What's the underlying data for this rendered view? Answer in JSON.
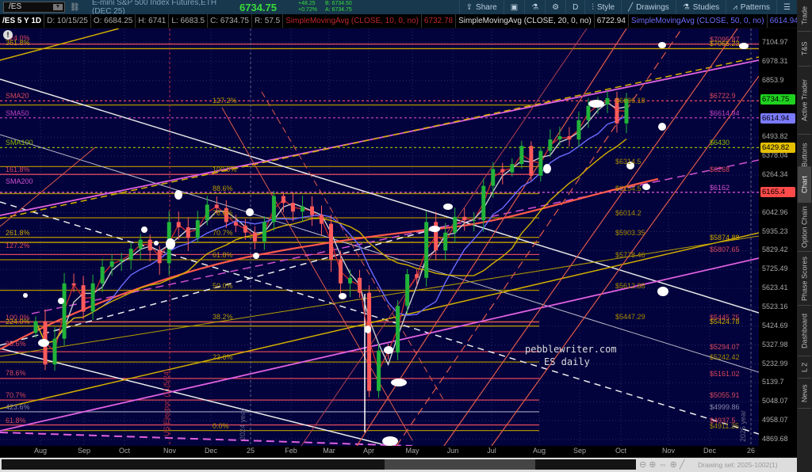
{
  "header": {
    "symbol": "/ES",
    "description": "E-mini S&P 500 Index Futures,ETH (DEC 25)",
    "last": "6734.75",
    "change": "+48.25",
    "change_pct": "+0.72%",
    "bid": "B: 6734.50",
    "ask": "A: 6734.75",
    "toolbar": [
      {
        "label": "Share",
        "icon": "share-icon"
      },
      {
        "label": "",
        "icon": "alert-icon"
      },
      {
        "label": "",
        "icon": "flask-icon"
      },
      {
        "label": "",
        "icon": "gear-icon"
      },
      {
        "label": "D",
        "icon": ""
      },
      {
        "label": "Style",
        "icon": "style-icon"
      },
      {
        "label": "Drawings",
        "icon": "pencil-icon"
      },
      {
        "label": "Studies",
        "icon": "flask-icon"
      },
      {
        "label": "Patterns",
        "icon": "patterns-icon"
      },
      {
        "label": "",
        "icon": "menu-icon"
      }
    ]
  },
  "status": {
    "period": "/ES 5 Y 1D",
    "date": "D: 10/15/25",
    "open": "O: 6684.25",
    "high": "H: 6741",
    "low": "L: 6683.5",
    "close": "C: 6734.75",
    "range": "R: 57.5",
    "studies": [
      {
        "name": "SimpleMovingAvg (CLOSE, 10, 0, no)",
        "value": "6732.78",
        "color": "#c0282d"
      },
      {
        "name": "SimpleMovingAvg (CLOSE, 20, 0, no)",
        "value": "6722.94",
        "color": "#dddddd"
      },
      {
        "name": "SimpleMovingAvg (CLOSE, 50, 0, no)",
        "value": "6614.94",
        "color": "#6b6bff"
      },
      {
        "name": "SimpleMoving...",
        "value": "",
        "color": "#d4b000"
      }
    ]
  },
  "axis": {
    "ticks": [
      "7104.97",
      "6978.31",
      "6853.9",
      "6493.82",
      "6378.04",
      "6264.34",
      "6042.96",
      "5935.23",
      "5829.42",
      "5725.49",
      "5623.41",
      "5523.16",
      "5424.69",
      "5327.98",
      "5232.99",
      "5139.7",
      "5048.07",
      "4958.07",
      "4869.68"
    ],
    "tags": [
      {
        "v": "6734.75",
        "color": "#1fd11f"
      },
      {
        "v": "6614.94",
        "color": "#7a7aff"
      },
      {
        "v": "6429.82",
        "color": "#e4c000"
      },
      {
        "v": "6165.4",
        "color": "#ff4a4a"
      }
    ]
  },
  "months": [
    "Aug",
    "Sep",
    "Oct",
    "Nov",
    "Dec",
    "25",
    "Feb",
    "Mar",
    "Apr",
    "May",
    "Jun",
    "Jul",
    "Aug",
    "Sep",
    "Oct",
    "Nov",
    "Dec",
    "26"
  ],
  "side_tabs": [
    "Trade",
    "T&S",
    "Active Trader",
    "Buttons",
    "Chart",
    "Option Chain",
    "Phase Scores",
    "Dashboard",
    "L 2",
    "News"
  ],
  "levels": [
    {
      "p": 7095.87,
      "label": "$7095.87",
      "color": "#d9485a"
    },
    {
      "p": 7065.23,
      "label": "$7065.23",
      "color": "#c9a400"
    },
    {
      "p": 6722.9,
      "label": "$6722.9",
      "color": "#d9485a",
      "dash": true
    },
    {
      "p": 6696.18,
      "label": "$6696.18",
      "color": "#a88a00"
    },
    {
      "p": 6614.94,
      "label": "$6614.94",
      "color": "#c040c0",
      "dash": true
    },
    {
      "p": 6430,
      "label": "$6430",
      "color": "#8db800",
      "dash": true
    },
    {
      "p": 6314.5,
      "label": "$6314.5",
      "color": "#a88a00"
    },
    {
      "p": 6268,
      "label": "$6268",
      "color": "#d9485a"
    },
    {
      "p": 6162,
      "label": "$6162",
      "color": "#d050d0",
      "dash": true
    },
    {
      "p": 6154.5,
      "label": "$6154.5",
      "color": "#a88a00"
    },
    {
      "p": 6014.2,
      "label": "$6014.2",
      "color": "#a88a00"
    },
    {
      "p": 5903.35,
      "label": "$5903.35",
      "color": "#a88a00"
    },
    {
      "p": 5874.88,
      "label": "$5874.88",
      "color": "#c9a400"
    },
    {
      "p": 5807.65,
      "label": "$5807.65",
      "color": "#d9485a"
    },
    {
      "p": 5778.46,
      "label": "$5778.46",
      "color": "#a88a00"
    },
    {
      "p": 5612.88,
      "label": "$5612.88",
      "color": "#a88a00"
    },
    {
      "p": 5447.29,
      "label": "$5447.29",
      "color": "#a88a00"
    },
    {
      "p": 5445.75,
      "label": "$5445.75",
      "color": "#d9485a"
    },
    {
      "p": 5424.78,
      "label": "$5424.78",
      "color": "#c9a400"
    },
    {
      "p": 5294.07,
      "label": "$5294.07",
      "color": "#d9485a"
    },
    {
      "p": 5242.42,
      "label": "$5242.42",
      "color": "#a88a00"
    },
    {
      "p": 5161.02,
      "label": "$5161.02",
      "color": "#d9485a"
    },
    {
      "p": 5055.91,
      "label": "$5055.91",
      "color": "#d9485a"
    },
    {
      "p": 4999.86,
      "label": "$4999.86",
      "color": "#8888aa"
    },
    {
      "p": 4937.5,
      "label": "$4937.5",
      "color": "#d9485a"
    },
    {
      "p": 4911.25,
      "label": "$4911.25",
      "color": "#a88a00"
    }
  ],
  "fib_mid": [
    {
      "p": 6268,
      "label": "100.0%"
    },
    {
      "p": 6154.5,
      "label": "88.6%"
    },
    {
      "p": 6014.2,
      "label": "78.6%"
    },
    {
      "p": 5903.35,
      "label": "70.7%"
    },
    {
      "p": 5778.46,
      "label": "61.8%"
    },
    {
      "p": 5612.88,
      "label": "50.0%"
    },
    {
      "p": 5447.29,
      "label": "38.2%"
    },
    {
      "p": 5242.42,
      "label": "23.6%"
    },
    {
      "p": 4911.25,
      "label": "0.0%"
    },
    {
      "p": 6696.18,
      "label": "127.2%"
    }
  ],
  "left_labels": [
    {
      "p": 7104,
      "label": "424.0%",
      "color": "#d9485a"
    },
    {
      "p": 7075,
      "label": "361.8%",
      "color": "#c9a400"
    },
    {
      "p": 6722.9,
      "label": "SMA20",
      "color": "#d9485a"
    },
    {
      "p": 6614.94,
      "label": "SMA50",
      "color": "#c040c0"
    },
    {
      "p": 6430,
      "label": "SMA100",
      "color": "#8db800"
    },
    {
      "p": 6268,
      "label": "161.8%",
      "color": "#d9485a"
    },
    {
      "p": 6200,
      "label": "SMA200",
      "color": "#d050d0"
    },
    {
      "p": 5900,
      "label": "261.8%",
      "color": "#c9a400"
    },
    {
      "p": 5830,
      "label": "127.2%",
      "color": "#d9485a"
    },
    {
      "p": 5445,
      "label": "100.0%",
      "color": "#d9485a"
    },
    {
      "p": 5425,
      "label": "224.0%",
      "color": "#c9a400"
    },
    {
      "p": 5310,
      "label": "88.6%",
      "color": "#d9485a"
    },
    {
      "p": 5165,
      "label": "78.6%",
      "color": "#d9485a"
    },
    {
      "p": 5055,
      "label": "70.7%",
      "color": "#d9485a"
    },
    {
      "p": 4999,
      "label": "423.6%",
      "color": "#8888aa"
    },
    {
      "p": 4937,
      "label": "61.8%",
      "color": "#d9485a"
    }
  ],
  "annotations": {
    "site": "pebblewriter.com",
    "subtitle": "ES daily",
    "election": "US Election (11/5/24)",
    "year2024": "2024 year",
    "year2025": "2025 year",
    "drawing_set": "Drawing set: 2025-1002(1)"
  },
  "chart_data": {
    "type": "candlestick",
    "title": "/ES 5 Y 1D",
    "ylim": [
      4869.68,
      7104.97
    ],
    "yscale": "log",
    "x_range": [
      "2024-07",
      "2026-01"
    ],
    "weekly_closes": [
      5450,
      5230,
      5360,
      5650,
      5640,
      5500,
      5650,
      5740,
      5770,
      5780,
      5840,
      5890,
      5830,
      5760,
      5990,
      5960,
      5900,
      6000,
      6090,
      6070,
      5990,
      5970,
      5930,
      5880,
      5990,
      6140,
      6100,
      6050,
      6080,
      6030,
      5980,
      5780,
      5650,
      5680,
      5600,
      5100,
      5300,
      5290,
      5530,
      5700,
      5680,
      5990,
      5830,
      5930,
      6020,
      6000,
      6000,
      6200,
      6300,
      6280,
      6330,
      6440,
      6260,
      6410,
      6480,
      6500,
      6480,
      6600,
      6690,
      6700,
      6740,
      6580,
      6734.75
    ]
  }
}
